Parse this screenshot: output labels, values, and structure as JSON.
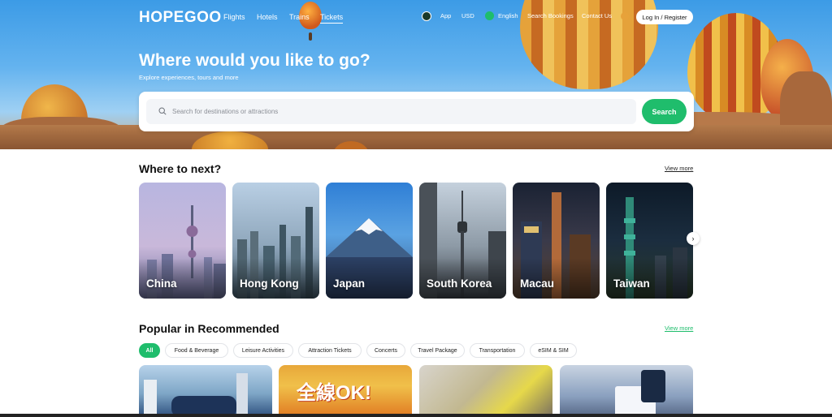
{
  "nav": {
    "logo": "HOPEGOO",
    "links": [
      "Flights",
      "Hotels",
      "Trains",
      "Tickets"
    ],
    "active_link": "Tickets",
    "app_label": "App",
    "currency": "USD",
    "language": "English",
    "search_bookings": "Search Bookings",
    "contact_us": "Contact Us",
    "login_label": "Log In / Register"
  },
  "hero": {
    "title": "Where would you like to go?",
    "subtitle": "Explore experiences, tours and more",
    "search_placeholder": "Search for destinations or attractions",
    "search_button": "Search"
  },
  "destinations": {
    "title": "Where to next?",
    "view_more": "View more",
    "items": [
      "China",
      "Hong Kong",
      "Japan",
      "South Korea",
      "Macau",
      "Taiwan"
    ]
  },
  "popular": {
    "title": "Popular in Recommended",
    "view_more": "View more",
    "categories": [
      "All",
      "Food & Beverage",
      "Leisure Activities",
      "Attraction Tickets",
      "Concerts",
      "Travel Package",
      "Transportation",
      "eSIM & SIM"
    ],
    "active_category": "All",
    "promo_text": "全線OK!"
  },
  "colors": {
    "accent": "#1fbd6c",
    "hero_sky": "#3c9be6",
    "text": "#111111"
  }
}
